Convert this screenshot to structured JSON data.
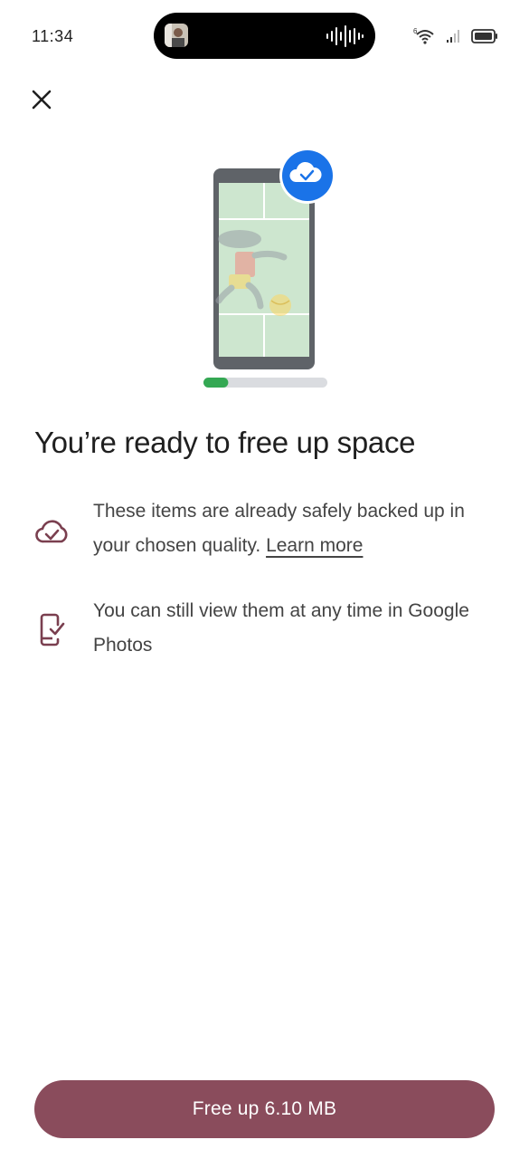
{
  "status_bar": {
    "time": "11:34",
    "wifi_icon": "wifi-icon",
    "signal_icon": "cellular-signal-icon",
    "battery_icon": "battery-icon",
    "audio_icon": "audio-waveform-icon"
  },
  "header": {
    "close_icon": "close-icon"
  },
  "illustration": {
    "badge_icon": "cloud-check-icon",
    "progress": 0.2
  },
  "main": {
    "title": "You’re ready to free up space",
    "rows": [
      {
        "icon": "cloud-check-outline-icon",
        "text": "These items are already safely backed up in your chosen quality.",
        "link": "Learn more"
      },
      {
        "icon": "phone-check-icon",
        "text": "You can still view them at any time in Google Photos"
      }
    ]
  },
  "footer": {
    "button_label": "Free up 6.10 MB"
  },
  "colors": {
    "primary": "#8a4c5c",
    "icon_tint": "#7a3f4f",
    "badge_blue": "#1a73e8",
    "progress_green": "#34a853",
    "track_gray": "#dadce0"
  }
}
